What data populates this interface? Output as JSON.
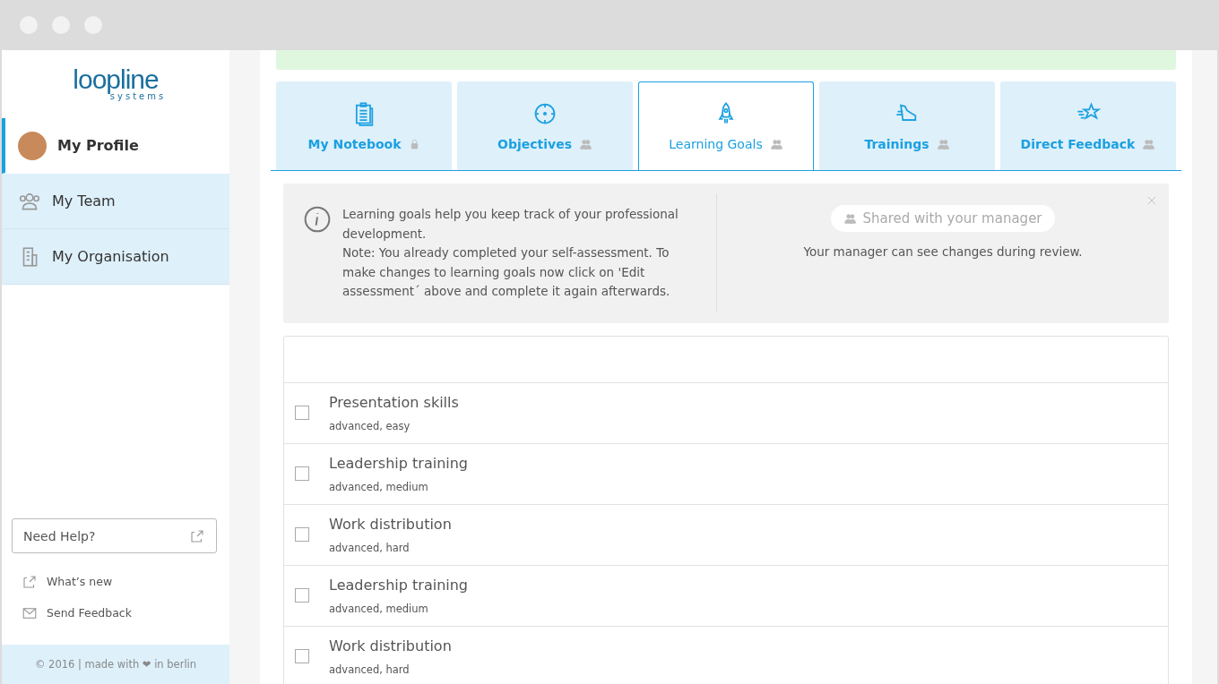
{
  "logo": {
    "name": "loopline",
    "tagline": "systems"
  },
  "sidebar": {
    "items": [
      {
        "label": "My Profile",
        "kind": "avatar",
        "selected": true
      },
      {
        "label": "My Team",
        "kind": "team",
        "selected": false
      },
      {
        "label": "My Organisation",
        "kind": "building",
        "selected": false
      }
    ],
    "help_button": "Need Help?",
    "links": [
      {
        "label": "What’s new",
        "kind": "external"
      },
      {
        "label": "Send Feedback",
        "kind": "mail"
      }
    ],
    "footer": "© 2016 | made with ❤ in berlin"
  },
  "tabs": [
    {
      "label": "My Notebook",
      "kind": "notebook",
      "shared": false,
      "selected": false
    },
    {
      "label": "Objectives",
      "kind": "target",
      "shared": true,
      "selected": false
    },
    {
      "label": "Learning Goals",
      "kind": "rocket",
      "shared": true,
      "selected": true
    },
    {
      "label": "Trainings",
      "kind": "shoe",
      "shared": true,
      "selected": false
    },
    {
      "label": "Direct Feedback",
      "kind": "star",
      "shared": true,
      "selected": false
    }
  ],
  "info": {
    "lines": [
      "Learning goals help you keep track of your professional development.",
      "Note: You already completed your self-assessment. To make changes to learning goals now click on 'Edit assessment´ above and complete it again afterwards."
    ],
    "shared_pill": "Shared with your manager",
    "shared_note": "Your manager can see changes during review."
  },
  "goals": [
    {
      "title": "Presentation skills",
      "detail": "advanced, easy",
      "checked": false
    },
    {
      "title": "Leadership training",
      "detail": "advanced, medium",
      "checked": false
    },
    {
      "title": "Work distribution",
      "detail": "advanced, hard",
      "checked": false
    },
    {
      "title": "Leadership training",
      "detail": "advanced, medium",
      "checked": false
    },
    {
      "title": "Work distribution",
      "detail": "advanced, hard",
      "checked": false
    }
  ]
}
